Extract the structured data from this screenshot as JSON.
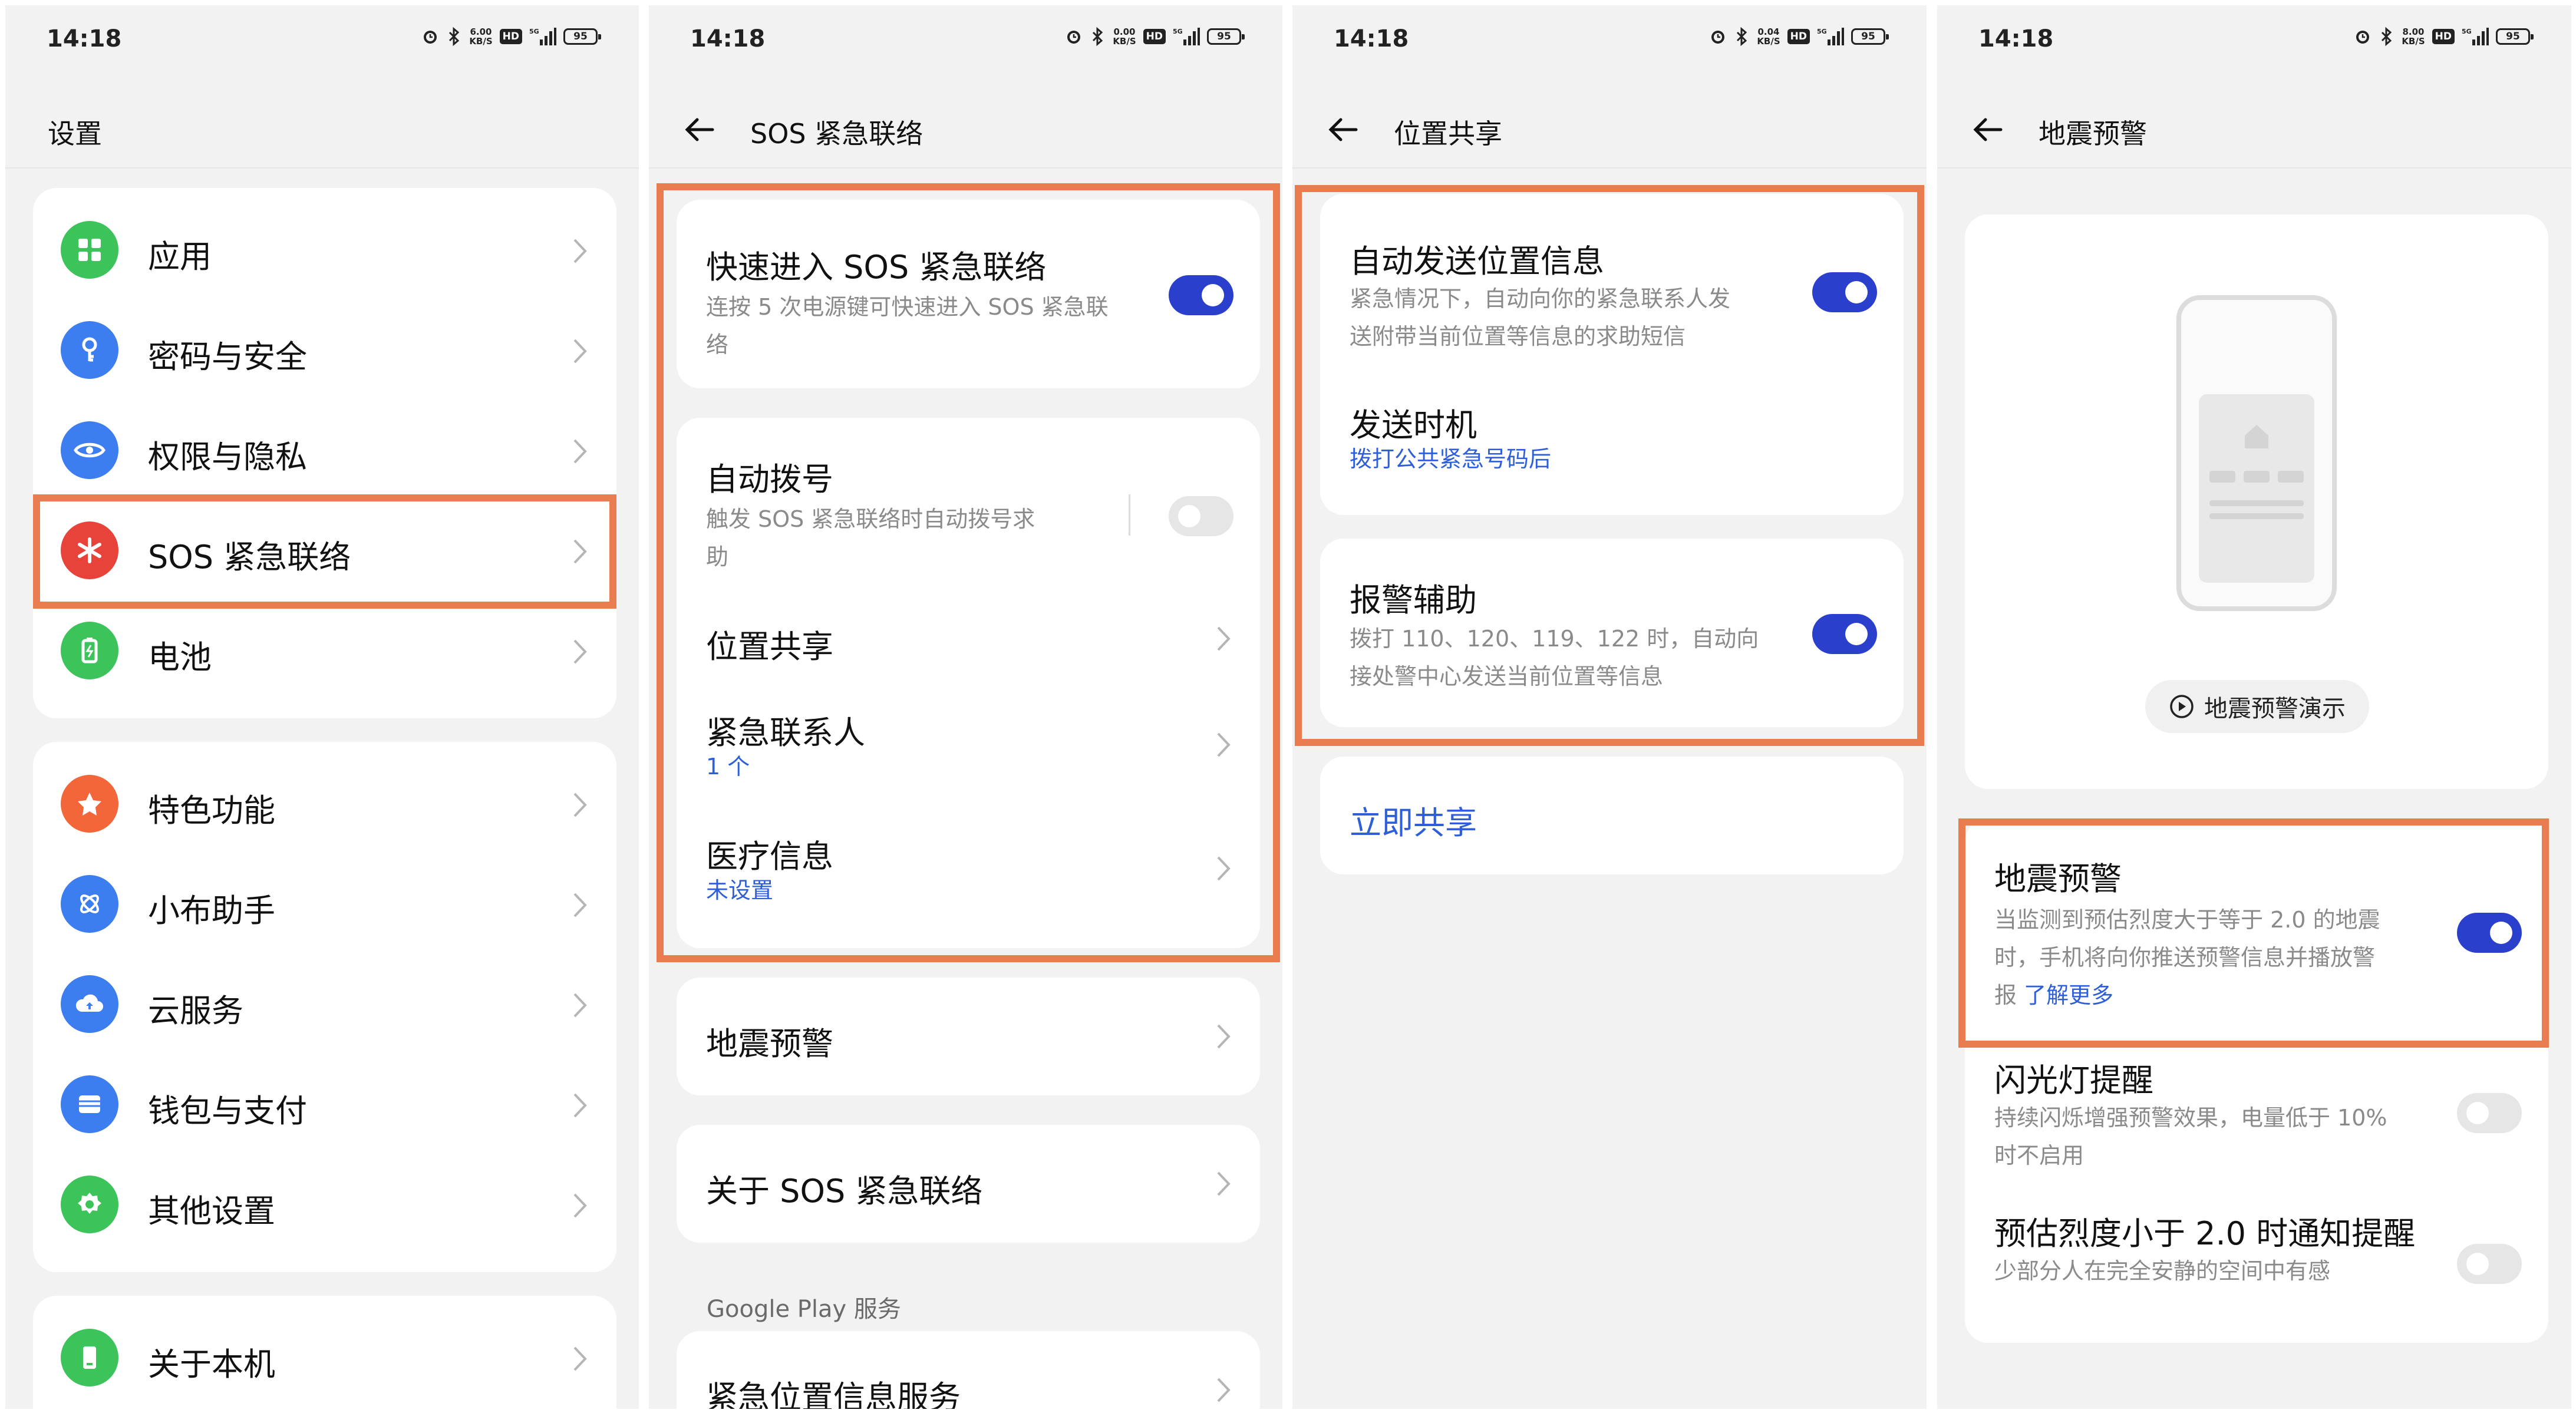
{
  "status": {
    "panel1": {
      "time": "14:18",
      "speed": "6.00",
      "battery": "95"
    },
    "panel2": {
      "time": "14:18",
      "speed": "0.00",
      "battery": "95"
    },
    "panel3": {
      "time": "14:18",
      "speed": "0.04",
      "battery": "95"
    },
    "panel4": {
      "time": "14:18",
      "speed": "8.00",
      "battery": "95"
    },
    "speed_unit": "KB/S",
    "hd": "HD",
    "network": "5G"
  },
  "settings": {
    "title": "设置",
    "group1": [
      {
        "label": "应用",
        "icon": "apps-icon",
        "color": "#3cc35a"
      },
      {
        "label": "密码与安全",
        "icon": "key-icon",
        "color": "#3c7df0"
      },
      {
        "label": "权限与隐私",
        "icon": "privacy-eye-icon",
        "color": "#3c7df0"
      },
      {
        "label": "SOS 紧急联络",
        "icon": "sos-asterisk-icon",
        "color": "#e8433a"
      },
      {
        "label": "电池",
        "icon": "battery-icon",
        "color": "#3cc35a"
      }
    ],
    "group2": [
      {
        "label": "特色功能",
        "icon": "star-icon",
        "color": "#f2663a"
      },
      {
        "label": "小布助手",
        "icon": "assistant-icon",
        "color": "#3c7df0"
      },
      {
        "label": "云服务",
        "icon": "cloud-icon",
        "color": "#3c7df0"
      },
      {
        "label": "钱包与支付",
        "icon": "wallet-icon",
        "color": "#3c7df0"
      },
      {
        "label": "其他设置",
        "icon": "gear-icon",
        "color": "#3cc35a"
      }
    ],
    "group3": [
      {
        "label": "关于本机",
        "icon": "phone-icon",
        "color": "#3cc35a"
      }
    ]
  },
  "sos": {
    "title": "SOS 紧急联络",
    "quick": {
      "label": "快速进入 SOS 紧急联络",
      "desc1": "连按 5 次电源键可快速进入 SOS 紧急联",
      "desc2": "络",
      "enabled": true
    },
    "auto_dial": {
      "label": "自动拨号",
      "desc1": "触发 SOS 紧急联络时自动拨号求",
      "desc2": "助",
      "enabled": false
    },
    "location_share": {
      "label": "位置共享"
    },
    "contacts": {
      "label": "紧急联系人",
      "value": "1 个"
    },
    "medical": {
      "label": "医疗信息",
      "value": "未设置"
    },
    "earthquake": {
      "label": "地震预警"
    },
    "about": {
      "label": "关于 SOS 紧急联络"
    },
    "section_google": "Google Play 服务",
    "emergency_location": {
      "label": "紧急位置信息服务"
    }
  },
  "location": {
    "title": "位置共享",
    "auto_send": {
      "label": "自动发送位置信息",
      "desc1": "紧急情况下，自动向你的紧急联系人发",
      "desc2": "送附带当前位置等信息的求助短信",
      "enabled": true
    },
    "send_timing": {
      "label": "发送时机",
      "value": "拨打公共紧急号码后"
    },
    "alarm_assist": {
      "label": "报警辅助",
      "desc1": "拨打 110、120、119、122 时，自动向",
      "desc2": "接处警中心发送当前位置等信息",
      "enabled": true
    },
    "share_now": "立即共享"
  },
  "earthquake": {
    "title": "地震预警",
    "demo_button": "地震预警演示",
    "warning": {
      "label": "地震预警",
      "desc1": "当监测到预估烈度大于等于 2.0 的地震",
      "desc2": "时，手机将向你推送预警信息并播放警",
      "desc3_prefix": "报",
      "learn_more": "了解更多",
      "enabled": true
    },
    "flash": {
      "label": "闪光灯提醒",
      "desc1": "持续闪烁增强预警效果，电量低于 10%",
      "desc2": "时不启用",
      "enabled": false
    },
    "low_intensity": {
      "label": "预估烈度小于 2.0 时通知提醒",
      "desc": "少部分人在完全安静的空间中有感",
      "enabled": false
    }
  },
  "colors": {
    "highlight": "#ea7d4f",
    "toggle_on": "#2a3fcc",
    "link": "#2e5fd8"
  }
}
